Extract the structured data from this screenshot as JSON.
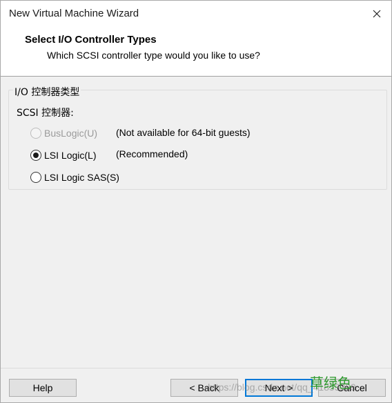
{
  "window": {
    "title": "New Virtual Machine Wizard"
  },
  "header": {
    "title": "Select I/O Controller Types",
    "subtitle": "Which SCSI controller type would you like to use?"
  },
  "group": {
    "legend": "I/O 控制器类型",
    "section_label": "SCSI 控制器:",
    "options": [
      {
        "label": "BusLogic(U)",
        "note": "(Not available for 64-bit guests)",
        "selected": false,
        "disabled": true
      },
      {
        "label": "LSI Logic(L)",
        "note": "(Recommended)",
        "selected": true,
        "disabled": false
      },
      {
        "label": "LSI Logic SAS(S)",
        "note": "",
        "selected": false,
        "disabled": false
      }
    ]
  },
  "footer": {
    "help_label": "Help",
    "back_label": "< Back",
    "next_label": "Next >",
    "cancel_label": "Cancel"
  },
  "watermark": {
    "url_text": "https://blog.csdn.net/qq_41853309",
    "cn_text": "草绿色"
  },
  "colors": {
    "accent": "#0078d7",
    "background": "#f0f0f0",
    "header_bg": "#ffffff"
  }
}
